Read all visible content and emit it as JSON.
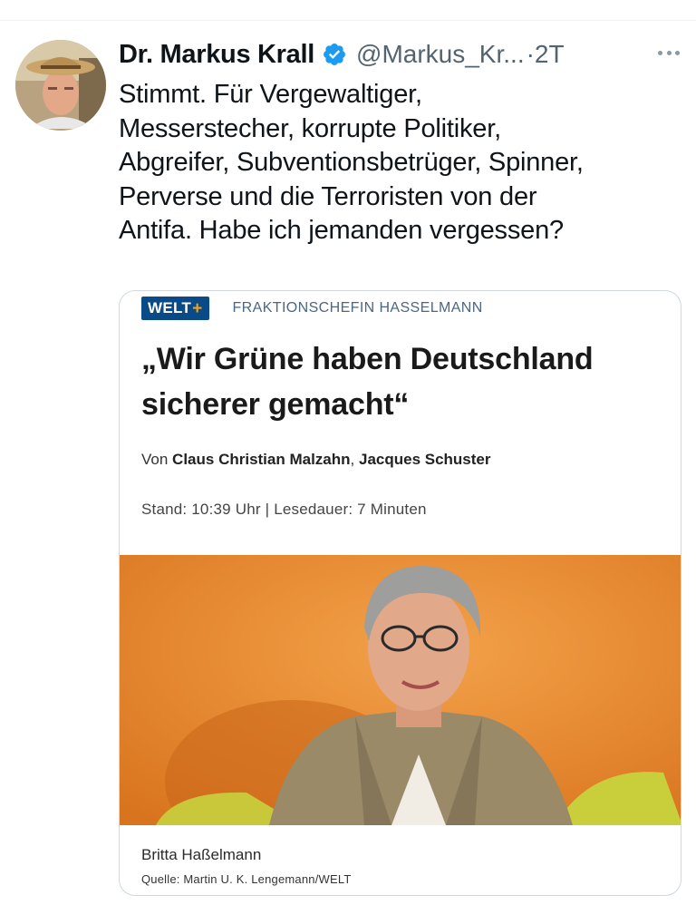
{
  "author": {
    "display_name": "Dr. Markus Krall",
    "handle": "@Markus_Kr...",
    "time": "·2T",
    "verified_icon": "verified-badge-icon",
    "avatar_icon": "profile-avatar"
  },
  "tweet": {
    "lines": [
      "Stimmt. Für Vergewaltiger,",
      "Messerstecher, korrupte Politiker,",
      "Abgreifer, Subventionsbetrüger, Spinner,",
      "Perverse und die Terroristen von der",
      "Antifa. Habe ich jemanden vergessen?"
    ]
  },
  "card": {
    "brand": "WELT",
    "brand_plus": "+",
    "kicker": "FRAKTIONSCHEFIN HASSELMANN",
    "headline_lines": [
      "„Wir Grüne haben Deutschland",
      "sicherer gemacht“"
    ],
    "byline_prefix": "Von ",
    "byline_author1": "Claus Christian Malzahn",
    "byline_sep": ", ",
    "byline_author2": "Jacques Schuster",
    "stand": "Stand: 10:39 Uhr  |  Lesedauer: 7 Minuten",
    "caption": "Britta Haßelmann",
    "source": "Quelle: Martin U. K. Lengemann/WELT"
  },
  "colors": {
    "brand_blue": "#0a4a87",
    "brand_plus": "#f0a020",
    "verified": "#1d9bf0",
    "photo_bg": "#e98e32"
  }
}
